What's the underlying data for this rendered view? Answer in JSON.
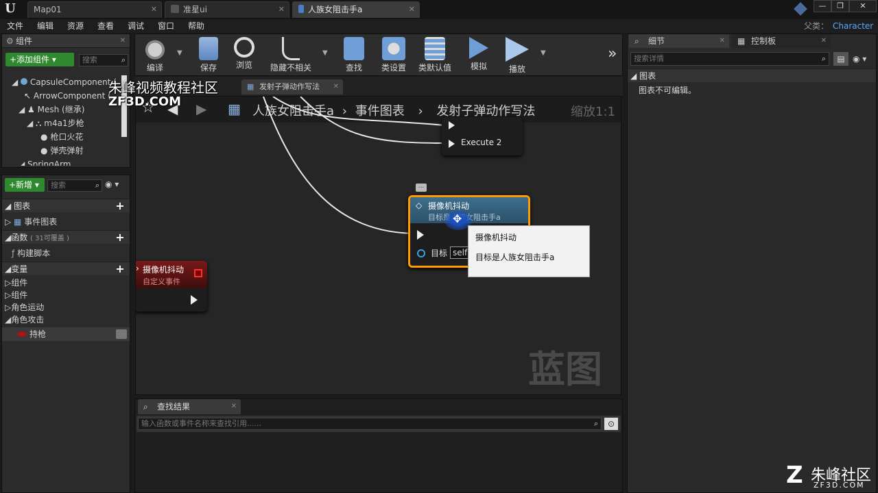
{
  "titlebar": {
    "logo": "U",
    "tabs": [
      {
        "label": "Map01"
      },
      {
        "label": "准星ui"
      },
      {
        "label": "人族女阻击手a"
      }
    ],
    "win_buttons": [
      "—",
      "❐",
      "✕"
    ]
  },
  "menubar": {
    "items": [
      "文件",
      "编辑",
      "资源",
      "查看",
      "调试",
      "窗口",
      "帮助"
    ],
    "parent_label": "父类：",
    "parent_value": "Character"
  },
  "components_panel": {
    "tab": "组件",
    "add_button": "+添加组件 ▾",
    "search_placeholder": "搜索",
    "tree": [
      {
        "label": "CapsuleComponent (",
        "indent": 1
      },
      {
        "label": "ArrowComponent (",
        "indent": 2
      },
      {
        "label": "Mesh (继承)",
        "indent": 2
      },
      {
        "label": "m4a1步枪",
        "indent": 3
      },
      {
        "label": "枪口火花",
        "indent": 4
      },
      {
        "label": "弹壳弹射",
        "indent": 4
      },
      {
        "label": "SpringArm",
        "indent": 2
      }
    ]
  },
  "mybp_panel": {
    "new_button": "+新增 ▾",
    "search_placeholder": "搜索",
    "sections": {
      "graph": "图表",
      "event_graph": "事件图表",
      "functions": "函数",
      "functions_count": "( 31可覆盖 )",
      "construct": "构建脚本",
      "variables": "变量",
      "var_groups": [
        "组件",
        "组件",
        "角色运动",
        "角色攻击"
      ],
      "var_item": "持枪"
    }
  },
  "toolbar": {
    "buttons": [
      "编译",
      "保存",
      "浏览",
      "隐藏不相关",
      "查找",
      "类设置",
      "类默认值",
      "模拟",
      "播放"
    ],
    "more": "»"
  },
  "graph_tab": {
    "label": "发射子弹动作写法",
    "breadcrumb": [
      "人族女阻击手a",
      "事件图表",
      "发射子弹动作写法"
    ],
    "zoom": "缩放1:1",
    "watermark": "蓝图"
  },
  "nodes": {
    "sequence_pin": "Execute 2",
    "camera_shake_title": "摄像机抖动",
    "camera_shake_subtitle": "目标是人族女阻击手a",
    "target_label": "目标",
    "target_value": "self",
    "custom_event_title": "摄像机抖动",
    "custom_event_subtitle": "自定义事件",
    "comment_icon": "..."
  },
  "tooltip": {
    "line1": "摄像机抖动",
    "line2": "目标是人族女阻击手a"
  },
  "find_panel": {
    "tab": "查找结果",
    "placeholder": "输入函数或事件名称来查找引用......"
  },
  "details_panel": {
    "tab": "细节",
    "tab2": "控制板",
    "search_placeholder": "搜索详情",
    "section": "图表",
    "message": "图表不可编辑。"
  },
  "overlays": {
    "wm_site": "朱峰视频教程社区",
    "wm_domain": "ZF3D.COM",
    "corner_brand": "朱峰社区",
    "corner_url": "ZF3D.COM"
  },
  "colors": {
    "accent": "#ff9a00",
    "link": "#5aa9ff",
    "green": "#2f8a2f"
  }
}
